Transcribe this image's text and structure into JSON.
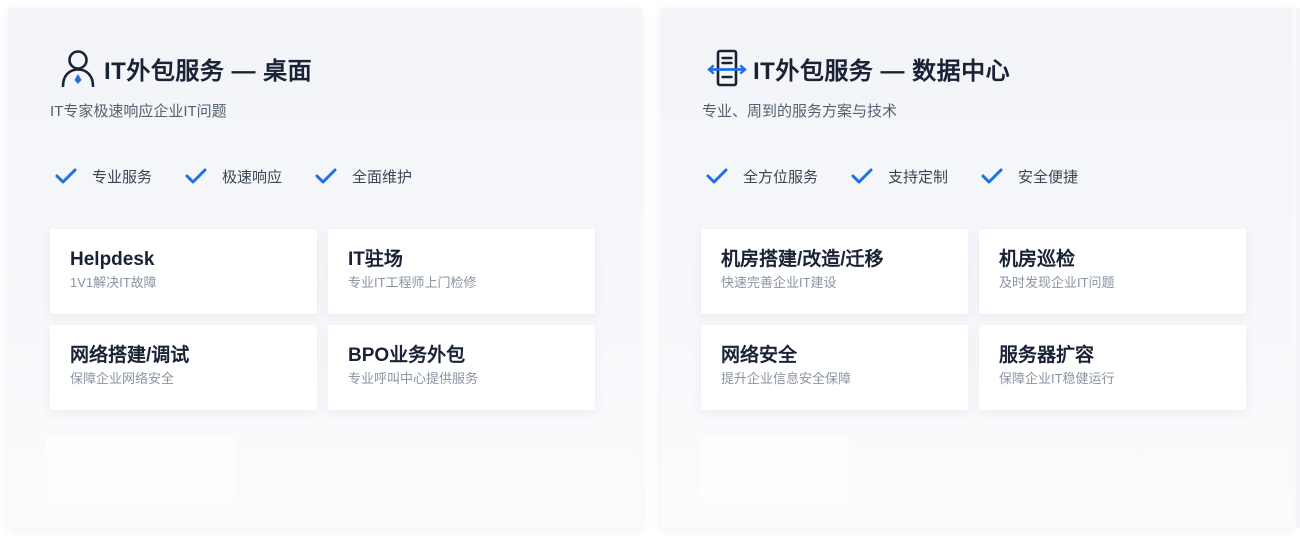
{
  "cards": [
    {
      "id": "desktop",
      "icon": "user-icon",
      "title": "IT外包服务 — 桌面",
      "subtitle": "IT专家极速响应企业IT问题",
      "features": [
        "专业服务",
        "极速响应",
        "全面维护"
      ],
      "services": [
        {
          "title": "Helpdesk",
          "desc": "1V1解决IT故障"
        },
        {
          "title": "IT驻场",
          "desc": "专业IT工程师上门检修"
        },
        {
          "title": "网络搭建/调试",
          "desc": "保障企业网络安全"
        },
        {
          "title": "BPO业务外包",
          "desc": "专业呼叫中心提供服务"
        }
      ]
    },
    {
      "id": "datacenter",
      "icon": "server-icon",
      "title": "IT外包服务 — 数据中心",
      "subtitle": "专业、周到的服务方案与技术",
      "features": [
        "全方位服务",
        "支持定制",
        "安全便捷"
      ],
      "services": [
        {
          "title": "机房搭建/改造/迁移",
          "desc": "快速完善企业IT建设"
        },
        {
          "title": "机房巡检",
          "desc": "及时发现企业IT问题"
        },
        {
          "title": "网络安全",
          "desc": "提升企业信息安全保障"
        },
        {
          "title": "服务器扩容",
          "desc": "保障企业IT稳健运行"
        }
      ]
    }
  ],
  "colors": {
    "accent": "#1f6fe5",
    "title": "#1a2236",
    "muted": "#8a94a3"
  }
}
